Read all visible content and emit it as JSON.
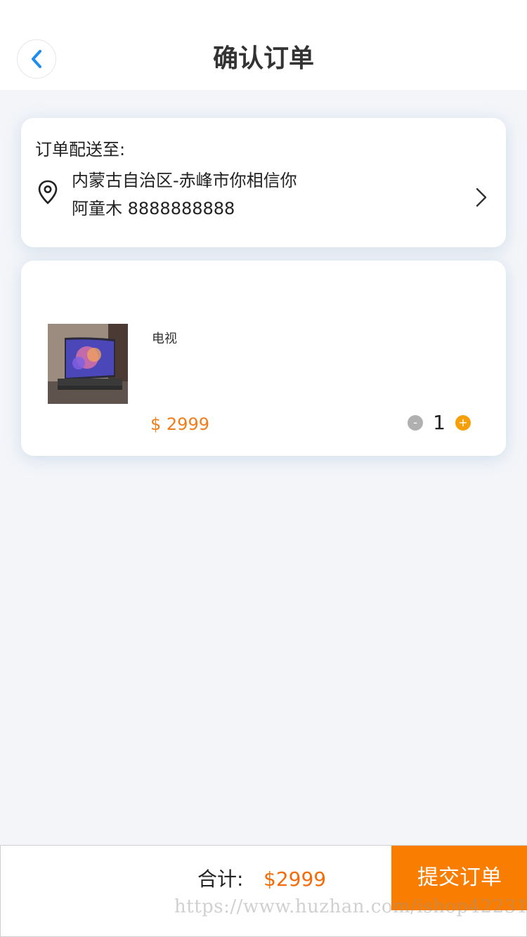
{
  "header": {
    "title": "确认订单",
    "back_icon": "chevron-left-icon",
    "accent": "#1e8cf0"
  },
  "address": {
    "label": "订单配送至:",
    "line1": "内蒙古自治区-赤峰市你相信你",
    "line2": "阿童木 8888888888"
  },
  "product": {
    "name": "电视",
    "price": "$ 2999",
    "quantity": "1",
    "minus_label": "-",
    "plus_label": "+"
  },
  "footer": {
    "total_label": "合计:",
    "total_value": "$2999",
    "submit_label": "提交订单"
  },
  "colors": {
    "price": "#f07d1b",
    "submit_bg": "#f97d00",
    "plus_bg": "#f5a00a",
    "page_bg": "#f3f5f9"
  },
  "watermark": "https://www.huzhan.com/ishop42231"
}
